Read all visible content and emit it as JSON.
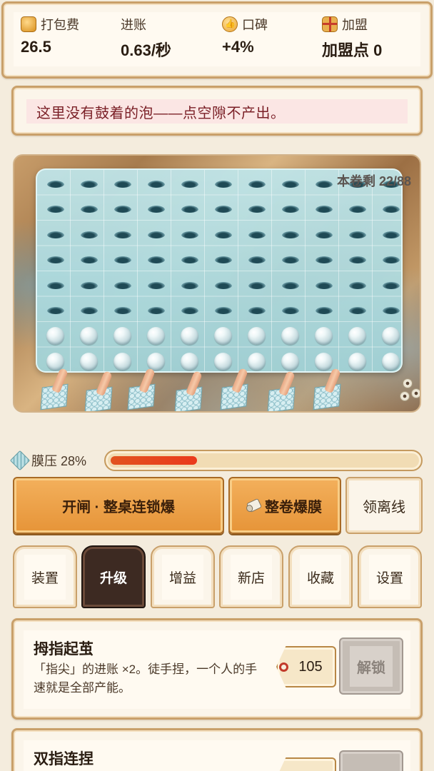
{
  "stats": {
    "pack_fee_label": "打包费",
    "pack_fee_value": "26.5",
    "income_label": "进账",
    "income_value": "0.63/秒",
    "reputation_label": "口碑",
    "reputation_value": "+4%",
    "franchise_label": "加盟",
    "franchise_value": "加盟点 0"
  },
  "message": "这里没有鼓着的泡——点空隙不产出。",
  "board": {
    "remaining": "本卷剩 22/88",
    "bubble_columns": 11,
    "bubble_rows": 8,
    "full_rows": 2
  },
  "pressure": {
    "label": "膜压 28%",
    "level": 0.28
  },
  "actions": {
    "gate_label": "开闸 · 整桌连锁爆",
    "pop_roll_label": "整卷爆膜",
    "collect_line_label": "领离线"
  },
  "tabs": [
    {
      "label": "装置",
      "active": false
    },
    {
      "label": "升级",
      "active": true
    },
    {
      "label": "增益",
      "active": false
    },
    {
      "label": "新店",
      "active": false
    },
    {
      "label": "收藏",
      "active": false
    },
    {
      "label": "设置",
      "active": false
    }
  ],
  "upgrades": [
    {
      "title": "拇指起茧",
      "desc": "「指尖」的进账 ×2。徒手捏，一个人的手速就是全部产能。",
      "price": "105",
      "unlock_label": "解锁"
    },
    {
      "title": "双指连捏",
      "desc": "",
      "price": "",
      "unlock_label": ""
    }
  ],
  "colors": {
    "accent": "#e69438",
    "active_tab": "#3d2a22",
    "message_bg": "#fbe6e4",
    "message_text": "#7a1f26",
    "pressure_fill": "#e2531f"
  }
}
